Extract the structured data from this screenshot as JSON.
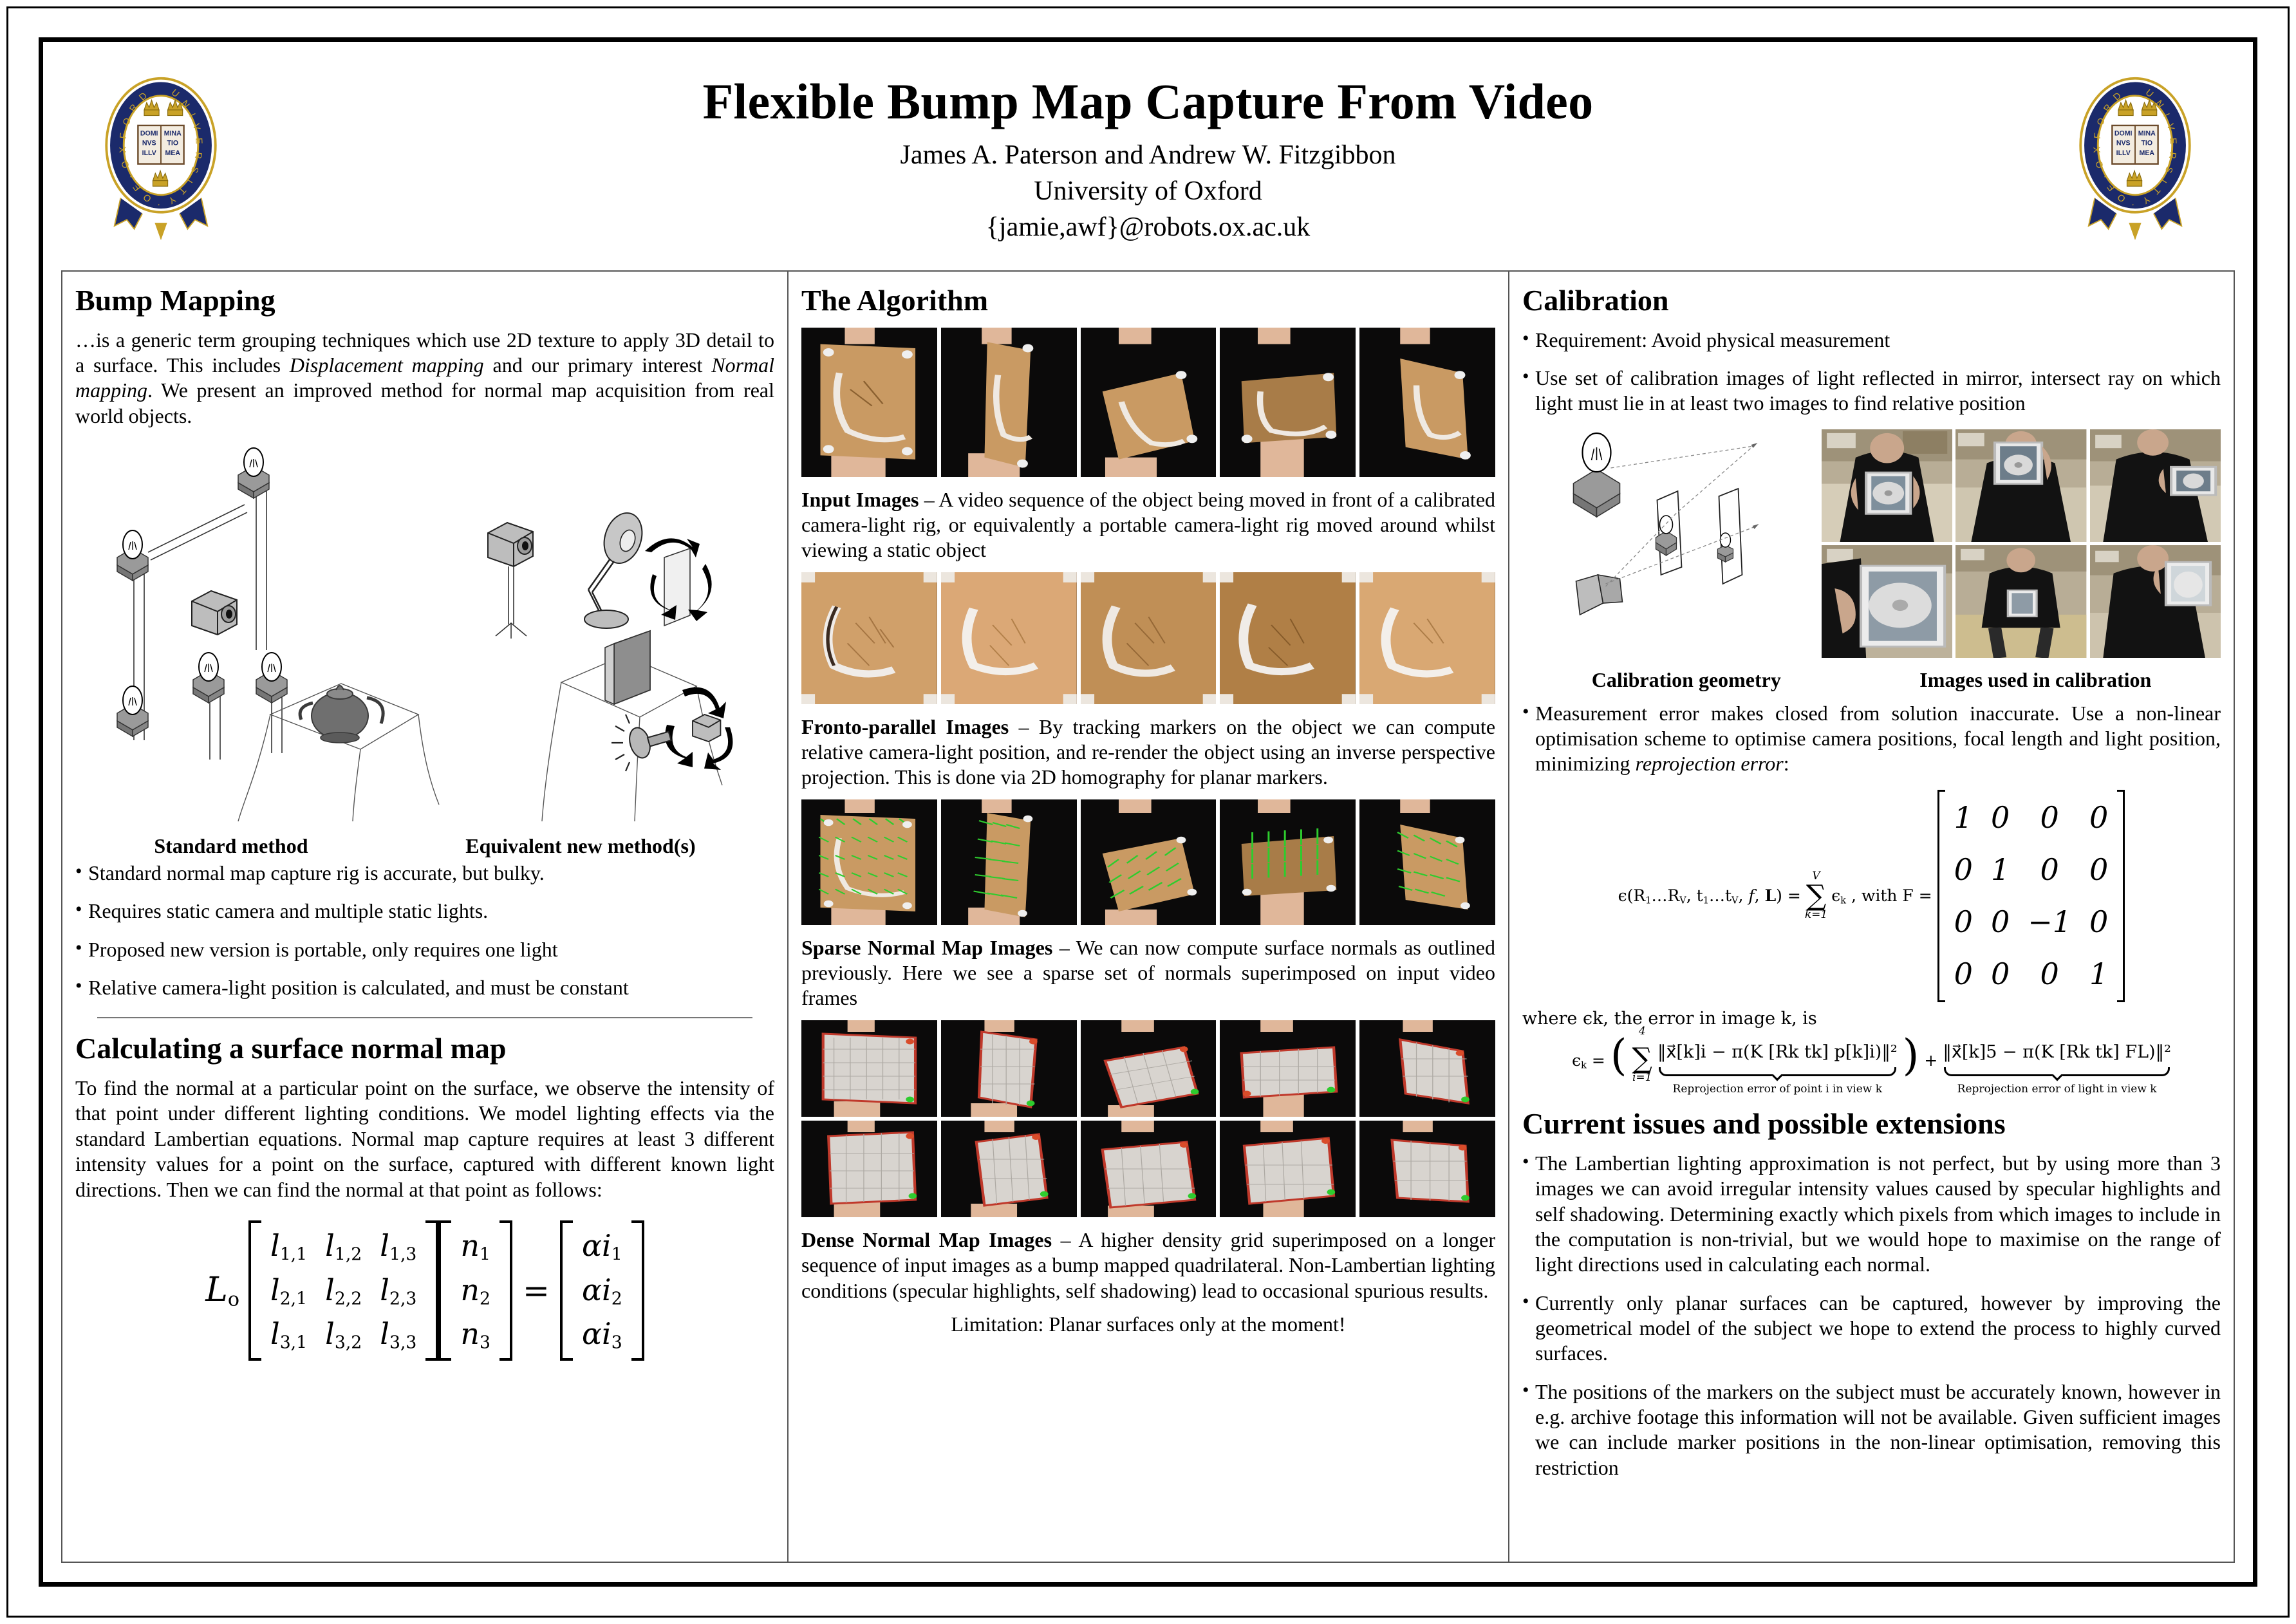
{
  "header": {
    "title": "Flexible Bump Map Capture From Video",
    "authors": "James A. Paterson and Andrew W. Fitzgibbon",
    "affiliation": "University of Oxford",
    "email": "{jamie,awf}@robots.ox.ac.uk",
    "crest_motto": "UNIVERSITY OF OXFORD",
    "crest_book": [
      "DOMI",
      "MINA",
      "NVS",
      "TIO",
      "ILLV",
      "MEA"
    ]
  },
  "left": {
    "section1_title": "Bump Mapping",
    "intro_part1": "…is a generic term grouping techniques which use 2D texture to apply 3D detail to a surface. This includes ",
    "intro_italic1": "Displacement mapping",
    "intro_part2": " and our primary interest ",
    "intro_italic2": "Normal mapping",
    "intro_part3": ". We present an improved method for normal map acquisition from real world objects.",
    "figure_caption_left": "Standard method",
    "figure_caption_right": "Equivalent new method(s)",
    "bullets": [
      "Standard normal map capture rig is accurate, but bulky.",
      "Requires static camera and multiple static lights.",
      "Proposed new version is portable, only requires one light",
      "Relative camera-light position is calculated, and must be constant"
    ],
    "section2_title": "Calculating a surface normal map",
    "section2_text": "To find the normal at a particular point on the surface, we observe the intensity of that point under different lighting conditions. We model lighting effects via the standard Lambertian equations. Normal map capture requires at least 3 different intensity values for a point on the surface, captured with different known light directions. Then we can find the normal at that point as follows:",
    "equation": {
      "lhs_symbol": "L",
      "lhs_sub": "o",
      "L_matrix": [
        [
          "l",
          "1,1",
          "l",
          "1,2",
          "l",
          "1,3"
        ],
        [
          "l",
          "2,1",
          "l",
          "2,2",
          "l",
          "2,3"
        ],
        [
          "l",
          "3,1",
          "l",
          "3,2",
          "l",
          "3,3"
        ]
      ],
      "n_vector": [
        [
          "n",
          "1"
        ],
        [
          "n",
          "2"
        ],
        [
          "n",
          "3"
        ]
      ],
      "equals": "=",
      "rhs_vector": [
        [
          "αi",
          "1"
        ],
        [
          "αi",
          "2"
        ],
        [
          "αi",
          "3"
        ]
      ]
    }
  },
  "middle": {
    "section_title": "The Algorithm",
    "input_label": "Input Images",
    "input_dash": " – ",
    "input_text": "A video sequence of the object being moved in front of a calibrated camera-light rig, or equivalently a portable camera-light rig moved around whilst viewing a static object",
    "fronto_label": "Fronto-parallel Images",
    "fronto_text": "By tracking markers on the object we can compute relative camera-light position, and re-render the object using an inverse perspective projection. This is done via 2D homography for planar markers.",
    "sparse_label": "Sparse Normal Map Images",
    "sparse_text": "We can now compute surface normals as outlined previously. Here we see a sparse set of normals superimposed on input video frames",
    "dense_label": "Dense Normal Map Images",
    "dense_text": "A higher density grid superimposed on a longer sequence of input images as a bump mapped quadrilateral. Non-Lambertian lighting conditions (specular highlights, self shadowing) lead to occasional spurious results.",
    "limitation": "Limitation: Planar surfaces only at the moment!"
  },
  "right": {
    "section1_title": "Calibration",
    "bullets_top": [
      "Requirement: Avoid physical measurement",
      "Use set of calibration images of light reflected in mirror, intersect ray on which light must lie in at least two images to find relative position"
    ],
    "caption_geometry": "Calibration geometry",
    "caption_images": "Images used in calibration",
    "measurement_pre": "Measurement error makes closed from solution inaccurate. Use a non-linear optimisation scheme to optimise camera positions, focal length and light position, minimizing ",
    "measurement_italic": "reprojection error",
    "measurement_post": ":",
    "equation1": {
      "lhs": "ϵ(R₁…R_V, t₁…t_V, f, L) =",
      "sum_upper": "V",
      "sum_lower": "k=1",
      "sum_body": "ϵk",
      "with_F": ", with F =",
      "F_matrix": [
        [
          "1",
          "0",
          "0",
          "0"
        ],
        [
          "0",
          "1",
          "0",
          "0"
        ],
        [
          "0",
          "0",
          "−1",
          "0"
        ],
        [
          "0",
          "0",
          "0",
          "1"
        ]
      ]
    },
    "where_line": "where ϵk, the error in image k, is",
    "equation2": {
      "lhs": "ϵk =",
      "sum_upper": "4",
      "sum_lower": "i=1",
      "term1": "‖x⃗[k]i − π(K [Rk  tk] p[k]i)‖²",
      "term1_label": "Reprojection error of point i in view k",
      "plus": "+",
      "term2": "‖x⃗[k]5 − π(K [Rk  tk] FL)‖²",
      "term2_label": "Reprojection error of light in view k"
    },
    "section2_title": "Current issues and possible extensions",
    "bullets_bottom": [
      "The Lambertian lighting approximation is not perfect, but by using more than 3 images we can avoid irregular intensity values caused by specular highlights and self shadowing. Determining exactly which pixels from which images to include in the computation is non-trivial, but we would hope to maximise on the range of light directions used in calculating each normal.",
      "Currently only planar surfaces can be captured, however by improving the geometrical model of the subject we hope to extend the process to highly curved surfaces.",
      "The positions of the markers on the subject must be accurately known, however in e.g. archive footage this information will not be available. Given sufficient images we can include marker positions in the non-linear optimisation, removing this restriction"
    ]
  },
  "colors": {
    "crest_blue": "#1b2a6b",
    "crest_gold": "#c9a227",
    "normal_green": "#2ecc2e",
    "card_tan": "#c99a63",
    "dark_bg": "#0b0a0a",
    "border": "#555555"
  }
}
